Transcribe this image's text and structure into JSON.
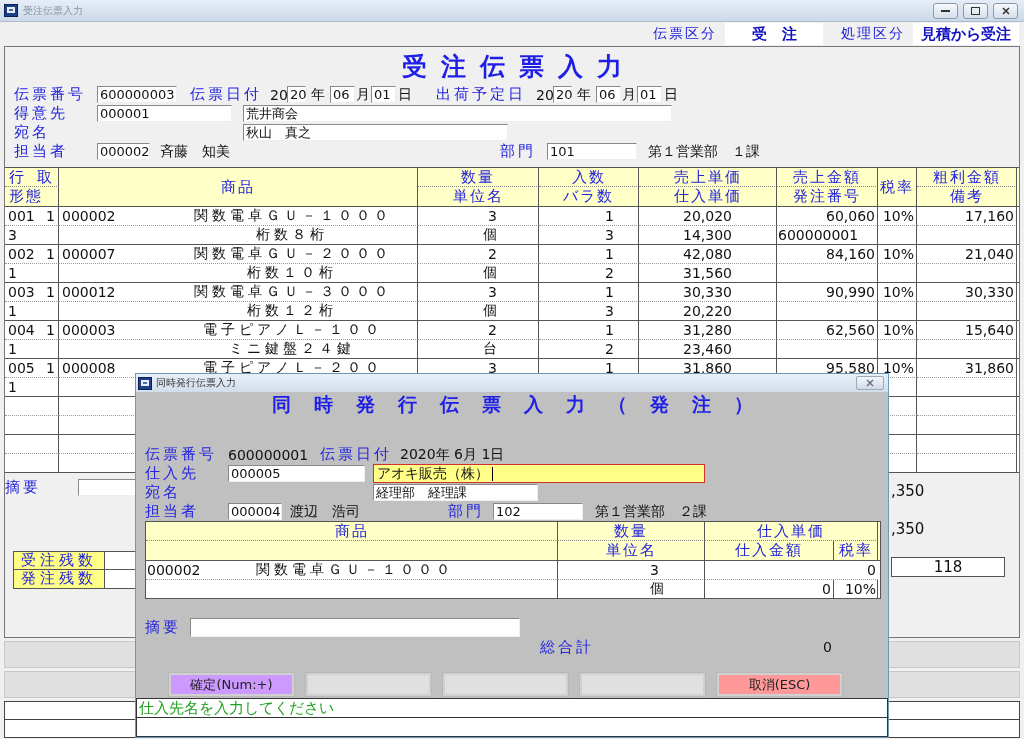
{
  "main_window": {
    "title": "受注伝票入力",
    "header_right": [
      {
        "label": "伝票区分",
        "value": "受　注"
      },
      {
        "label": "処理区分",
        "value": "見積から受注"
      }
    ],
    "heading": "受注伝票入力",
    "slip_no": {
      "label": "伝票番号",
      "value": "600000003"
    },
    "slip_date": {
      "label": "伝票日付",
      "century": "20",
      "year": "20",
      "year_unit": "年",
      "month": "06",
      "month_unit": "月",
      "day": "01",
      "day_unit": "日"
    },
    "ship_date": {
      "label": "出荷予定日",
      "century": "20",
      "year": "20",
      "year_unit": "年",
      "month": "06",
      "month_unit": "月",
      "day": "01",
      "day_unit": "日"
    },
    "customer": {
      "label": "得意先",
      "code": "000001",
      "name": "荒井商会"
    },
    "addressee": {
      "label": "宛名",
      "value": "秋山　真之"
    },
    "staff": {
      "label": "担当者",
      "code": "000002",
      "name": "斉藤　知美"
    },
    "department": {
      "label": "部門",
      "code": "101",
      "name": "第１営業部　１課"
    },
    "table": {
      "columns": [
        {
          "top": "行",
          "top_right": "取",
          "bottom": "形態"
        },
        {
          "top": "商品"
        },
        {
          "top": "数量",
          "bottom": "単位名"
        },
        {
          "top": "入数",
          "bottom": "バラ数"
        },
        {
          "top": "売上単価",
          "bottom": "仕入単価"
        },
        {
          "top": "売上金額",
          "bottom": "発注番号"
        },
        {
          "top": "税率"
        },
        {
          "top": "粗利金額",
          "bottom": "備考"
        }
      ],
      "rows": [
        {
          "line": "001",
          "deal": "1",
          "code": "000002",
          "product": "関数電卓ＧＵ－１０００",
          "quantity": "3",
          "case_qty": "1",
          "sale_price": "20,020",
          "amount": "60,060",
          "tax": "10%",
          "profit": "17,160",
          "form": "3",
          "spec": "桁数８桁",
          "unit": "個",
          "pieces": "3",
          "cost": "14,300",
          "order_no": "600000001"
        },
        {
          "line": "002",
          "deal": "1",
          "code": "000007",
          "product": "関数電卓ＧＵ－２０００",
          "quantity": "2",
          "case_qty": "1",
          "sale_price": "42,080",
          "amount": "84,160",
          "tax": "10%",
          "profit": "21,040",
          "form": "1",
          "spec": "桁数１０桁",
          "unit": "個",
          "pieces": "2",
          "cost": "31,560"
        },
        {
          "line": "003",
          "deal": "1",
          "code": "000012",
          "product": "関数電卓ＧＵ－３０００",
          "quantity": "3",
          "case_qty": "1",
          "sale_price": "30,330",
          "amount": "90,990",
          "tax": "10%",
          "profit": "30,330",
          "form": "1",
          "spec": "桁数１２桁",
          "unit": "個",
          "pieces": "3",
          "cost": "20,220"
        },
        {
          "line": "004",
          "deal": "1",
          "code": "000003",
          "product": "電子ピアノＬ－１００",
          "quantity": "2",
          "case_qty": "1",
          "sale_price": "31,280",
          "amount": "62,560",
          "tax": "10%",
          "profit": "15,640",
          "form": "1",
          "spec": "ミニ鍵盤２４鍵",
          "unit": "台",
          "pieces": "2",
          "cost": "23,460"
        },
        {
          "line": "005",
          "deal": "1",
          "code": "000008",
          "product": "電子ピアノＬ－２００",
          "quantity": "3",
          "case_qty": "1",
          "sale_price": "31,860",
          "amount": "95,580",
          "tax": "10%",
          "profit": "31,860",
          "form": "1"
        }
      ]
    },
    "summary": {
      "memo_label": "摘要",
      "remaining": [
        "受注残数",
        "発注残数"
      ],
      "totals": [
        ",350",
        ",350"
      ],
      "count": "118"
    }
  },
  "dialog": {
    "title": "同時発行伝票入力",
    "heading": "同時発行伝票入力（発注）",
    "slip_no": {
      "label": "伝票番号",
      "value": "600000001"
    },
    "slip_date": {
      "label": "伝票日付",
      "value": "2020年 6月 1日"
    },
    "supplier": {
      "label": "仕入先",
      "code": "000005",
      "name": "アオキ販売（株）",
      "focused": true
    },
    "addressee": {
      "label": "宛名",
      "value": "経理部　経理課"
    },
    "staff": {
      "label": "担当者",
      "code": "000004",
      "name": "渡辺　浩司"
    },
    "department": {
      "label": "部門",
      "code": "102",
      "name": "第１営業部　２課"
    },
    "table": {
      "columns": [
        {
          "top": "商品"
        },
        {
          "top": "数量",
          "bottom": "単位名"
        },
        {
          "top": "仕入単価",
          "bottom": "仕入金額",
          "bottom_right": "税率"
        }
      ],
      "rows": [
        {
          "code": "000002",
          "product": "関数電卓ＧＵ－１０００",
          "quantity": "3",
          "cost": "0",
          "unit": "個",
          "amount": "0",
          "tax": "10%"
        }
      ]
    },
    "memo": {
      "label": "摘要"
    },
    "total": {
      "label": "総合計",
      "value": "0"
    },
    "buttons": [
      {
        "kind": "confirm",
        "label": "確定(Num:+)"
      },
      {
        "kind": "blank"
      },
      {
        "kind": "blank"
      },
      {
        "kind": "blank"
      },
      {
        "kind": "cancel",
        "label": "取消(ESC)"
      }
    ],
    "status_message": "仕入先名を入力してください"
  }
}
